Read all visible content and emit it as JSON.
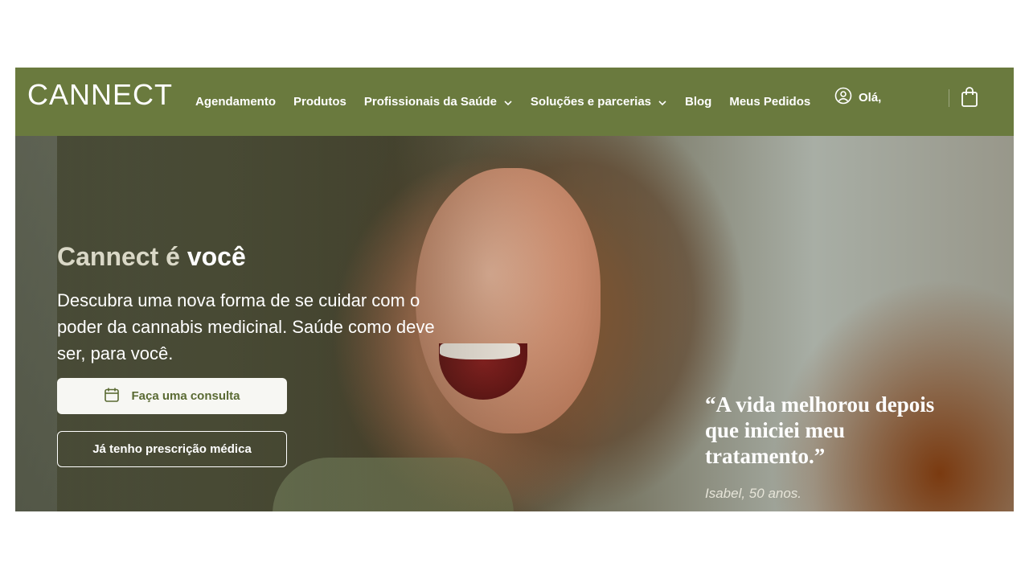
{
  "brand": {
    "logo_text": "CANNECT",
    "color": "#6a7a3e"
  },
  "nav": {
    "items": [
      {
        "label": "Agendamento",
        "has_dropdown": false
      },
      {
        "label": "Produtos",
        "has_dropdown": false
      },
      {
        "label": "Profissionais da Saúde",
        "has_dropdown": true
      },
      {
        "label": "Soluções e parcerias",
        "has_dropdown": true
      },
      {
        "label": "Blog",
        "has_dropdown": false
      },
      {
        "label": "Meus Pedidos",
        "has_dropdown": false
      }
    ],
    "user_label": "Olá,",
    "icons": {
      "user": "user-circle-icon",
      "cart": "shopping-bag-icon",
      "dropdown": "chevron-down-icon"
    }
  },
  "hero": {
    "title_prefix": "Cannect é",
    "title_emphasis": "você",
    "subtitle": "Descubra uma nova forma de se cuidar com o poder da cannabis medicinal. Saúde como deve ser, para você.",
    "primary_button": "Faça uma consulta",
    "primary_icon": "calendar-icon",
    "secondary_button": "Já tenho prescrição médica",
    "quote": "“A vida melhorou depois que iniciei meu tratamento.”",
    "quote_author": "Isabel, 50 anos."
  }
}
